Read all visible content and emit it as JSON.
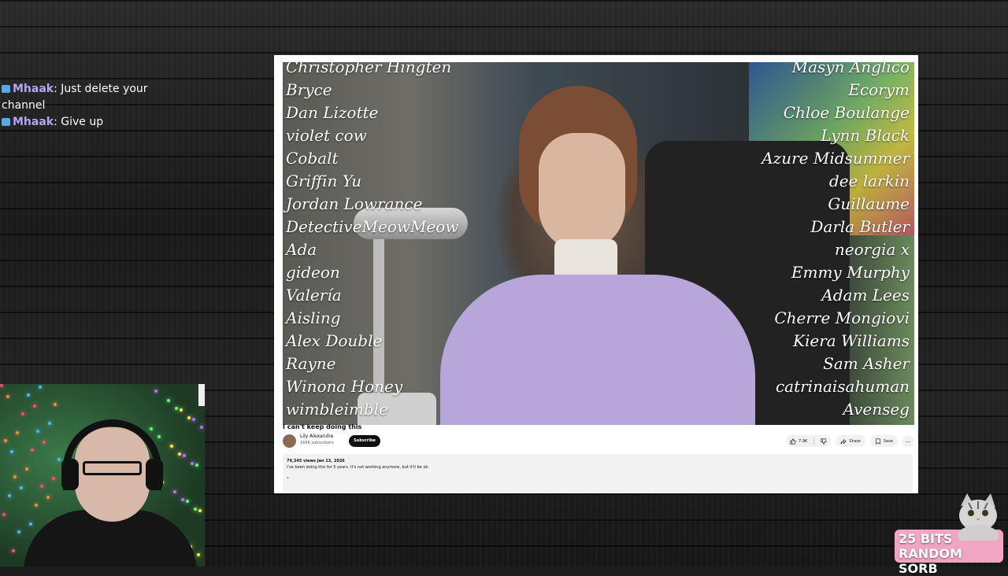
{
  "chat": {
    "messages": [
      {
        "user": "Mhaak",
        "text": ": Just delete your channel"
      },
      {
        "user": "Mhaak",
        "text": ": Give up"
      }
    ]
  },
  "video": {
    "credits_left": [
      "Christopher Hingten",
      "Bryce",
      "Dan Lizotte",
      "violet cow",
      "Cobalt",
      "Griffin Yu",
      "Jordan Lowrance",
      "DetectiveMeowMeow",
      "Ada",
      "gideon",
      "Valería",
      "Aisling",
      "Alex Double",
      "Rayne",
      "Winona Honey",
      "wimbleimble"
    ],
    "credits_right": [
      "Masyn Anglico",
      "Ecorym",
      "Chloe Boulange",
      "Lynn Black",
      "Azure Midsummer",
      "dee larkin",
      "Guillaume",
      "Darla Butler",
      "neorgia x",
      "Emmy Murphy",
      "Adam Lees",
      "Cherre Mongiovi",
      "Kiera Williams",
      "Sam Asher",
      "catrinaisahuman",
      "Avenseg"
    ],
    "title": "I can't keep doing this",
    "channel": "Lily Alexandre",
    "subscribers": "166K subscribers",
    "subscribe_label": "Subscribe",
    "likes": "7.9K",
    "share_label": "Share",
    "save_label": "Save",
    "more_label": "...",
    "description_stats": "79,345 views  Jan 13, 2026",
    "description_text": "I've been doing this for 5 years. It's not working anymore, but it'll be ok.",
    "description_bullet": "•"
  },
  "overlay": {
    "bits_line1": "25 BITS",
    "bits_line2": "RANDOM SORB"
  },
  "colors": {
    "chat_user": "#b5a6f5",
    "badge": "#5aa8e6",
    "bits_bg": "#f0a6c3"
  }
}
